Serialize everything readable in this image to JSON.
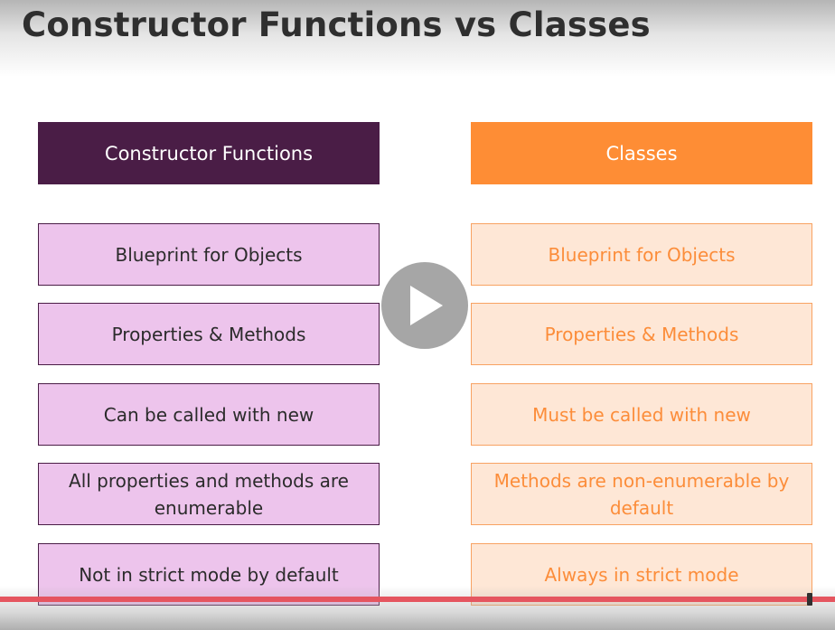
{
  "slide": {
    "title": "Constructor Functions vs Classes"
  },
  "comparison": {
    "left_header": "Constructor Functions",
    "right_header": "Classes",
    "rows": [
      {
        "left": "Blueprint for Objects",
        "right": "Blueprint for Objects"
      },
      {
        "left": "Properties & Methods",
        "right": "Properties & Methods"
      },
      {
        "left": "Can be called with new",
        "right": "Must be called with new"
      },
      {
        "left": "All properties and methods are enumerable",
        "right": "Methods are non-enumerable by default"
      },
      {
        "left": "Not in strict mode by default",
        "right": "Always in strict mode"
      }
    ]
  },
  "player": {
    "play_icon": "play-icon",
    "progress_fraction": 0.97
  },
  "colors": {
    "left_header_bg": "#4a1d46",
    "left_cell_bg": "#edc4ec",
    "right_header_bg": "#fe8d35",
    "right_cell_bg": "#fee7d6",
    "right_text": "#fc8d3a",
    "progress_bar": "#e5555f"
  }
}
